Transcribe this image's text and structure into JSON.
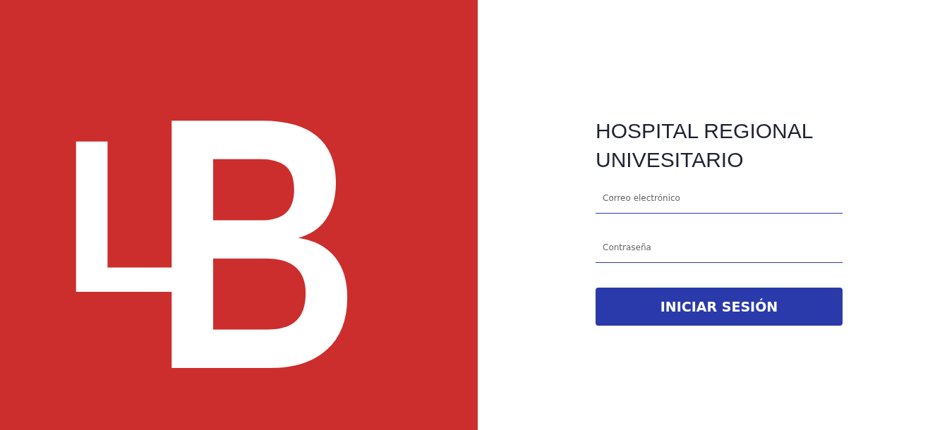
{
  "logo": {
    "letters": [
      "L",
      "B"
    ]
  },
  "title": "HOSPITAL REGIONAL UNIVESITARIO",
  "fields": [
    {
      "placeholder": "Correo electrónico"
    },
    {
      "placeholder": "Contraseña"
    }
  ],
  "button": "INICIAR SESIÓN"
}
